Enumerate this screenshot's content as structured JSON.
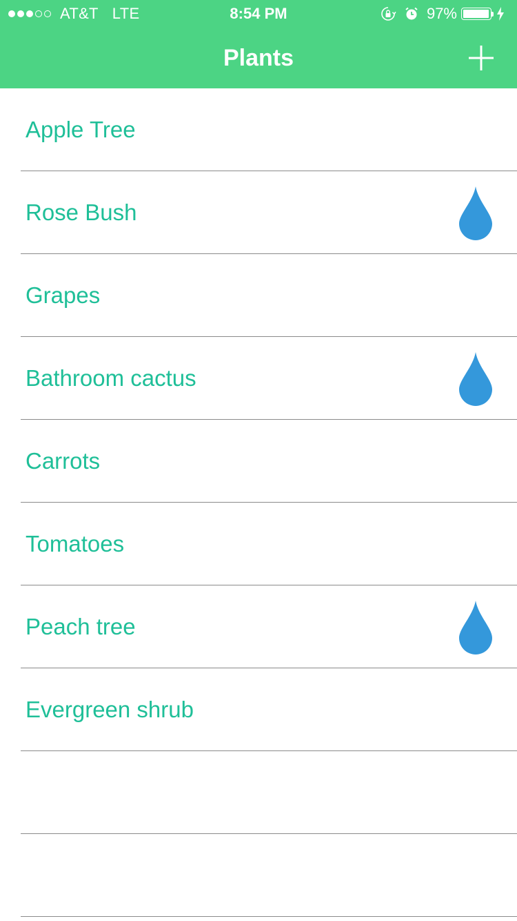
{
  "status_bar": {
    "signal_bars_filled": 3,
    "signal_bars_total": 5,
    "carrier": "AT&T",
    "network": "LTE",
    "time": "8:54 PM",
    "icons": [
      "rotation-lock-icon",
      "alarm-icon",
      "charging-bolt-icon"
    ],
    "battery_percent_label": "97%",
    "battery_level": 0.97
  },
  "nav": {
    "title": "Plants",
    "add_icon": "plus-icon"
  },
  "plants": [
    {
      "name": "Apple Tree",
      "needs_water": false
    },
    {
      "name": "Rose Bush",
      "needs_water": true
    },
    {
      "name": "Grapes",
      "needs_water": false
    },
    {
      "name": "Bathroom cactus",
      "needs_water": true
    },
    {
      "name": "Carrots",
      "needs_water": false
    },
    {
      "name": "Tomatoes",
      "needs_water": false
    },
    {
      "name": "Peach tree",
      "needs_water": true
    },
    {
      "name": "Evergreen shrub",
      "needs_water": false
    },
    {
      "name": "",
      "needs_water": false
    },
    {
      "name": "",
      "needs_water": false
    }
  ],
  "colors": {
    "header_green": "#4cd484",
    "plant_text": "#1fbf98",
    "water_drop": "#3498db",
    "separator": "#8a8a8a"
  }
}
